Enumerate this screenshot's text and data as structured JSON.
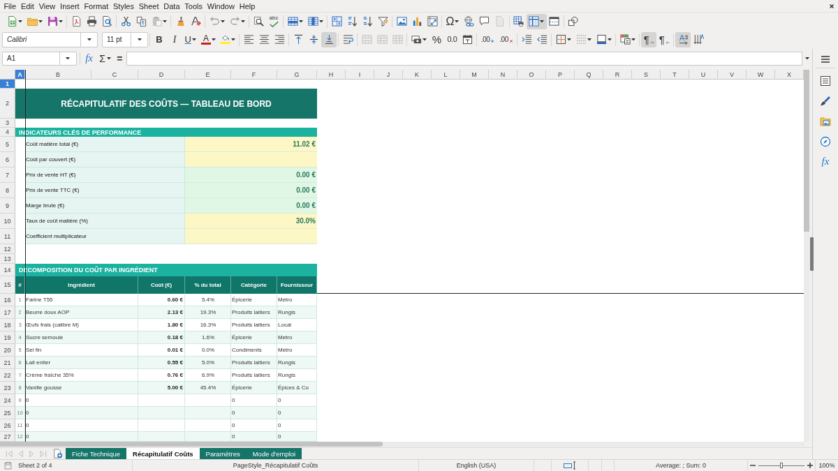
{
  "menu_bar": [
    "File",
    "Edit",
    "View",
    "Insert",
    "Format",
    "Styles",
    "Sheet",
    "Data",
    "Tools",
    "Window",
    "Help"
  ],
  "standard_toolbar": [
    {
      "pressed": false,
      "disabled": false
    },
    {
      "pressed": false,
      "disabled": false
    },
    {
      "pressed": false,
      "disabled": false
    },
    {
      "pressed": false,
      "disabled": false
    },
    {
      "pressed": false,
      "disabled": false
    },
    {
      "pressed": false,
      "disabled": false
    },
    {
      "pressed": false,
      "disabled": false
    },
    {
      "pressed": false,
      "disabled": false
    },
    {
      "pressed": false,
      "disabled": true
    },
    {
      "pressed": false,
      "disabled": false
    },
    {
      "pressed": false,
      "disabled": false
    },
    {
      "pressed": false,
      "disabled": true
    },
    {
      "pressed": false,
      "disabled": true
    },
    {
      "pressed": false,
      "disabled": false
    },
    {
      "glyph": "abc",
      "pressed": false,
      "disabled": false
    },
    {
      "pressed": false,
      "disabled": false
    },
    {
      "pressed": false,
      "disabled": false
    },
    {
      "pressed": false,
      "disabled": false
    },
    {
      "pressed": false,
      "disabled": false
    },
    {
      "pressed": false,
      "disabled": false
    },
    {
      "pressed": false,
      "disabled": false
    },
    {
      "pressed": false,
      "disabled": false
    },
    {
      "pressed": false,
      "disabled": false
    },
    {
      "pressed": false,
      "disabled": false
    },
    {
      "glyph": "Ω",
      "pressed": false,
      "disabled": false
    },
    {
      "pressed": false,
      "disabled": false
    },
    {
      "pressed": false,
      "disabled": false
    },
    {
      "pressed": false,
      "disabled": true
    },
    {
      "pressed": false,
      "disabled": false
    },
    {
      "pressed": true,
      "disabled": false
    },
    {
      "pressed": false,
      "disabled": false
    },
    {
      "pressed": false,
      "disabled": false
    }
  ],
  "formatting_toolbar": {
    "font_name": "Calibri",
    "font_size": "11 pt",
    "buttons": [
      {
        "glyph": "B",
        "pressed": false,
        "disabled": false
      },
      {
        "glyph": "I",
        "pressed": false,
        "disabled": false
      },
      {
        "glyph": "U",
        "pressed": false,
        "disabled": false
      },
      {
        "glyph": "A",
        "pressed": false,
        "disabled": false
      },
      {
        "pressed": false,
        "disabled": false
      },
      {
        "pressed": false,
        "disabled": false
      },
      {
        "pressed": false,
        "disabled": false
      },
      {
        "pressed": false,
        "disabled": false
      },
      {
        "pressed": false,
        "disabled": false
      },
      {
        "pressed": false,
        "disabled": false
      },
      {
        "pressed": true,
        "disabled": false
      },
      {
        "pressed": false,
        "disabled": false
      },
      {
        "pressed": false,
        "disabled": true
      },
      {
        "pressed": false,
        "disabled": true
      },
      {
        "pressed": false,
        "disabled": true
      },
      {
        "pressed": false,
        "disabled": false
      },
      {
        "glyph": "%",
        "pressed": false,
        "disabled": false
      },
      {
        "glyph": "0.0",
        "pressed": false,
        "disabled": false
      },
      {
        "pressed": false,
        "disabled": false
      },
      {
        "glyph": ".00",
        "pressed": false,
        "disabled": false
      },
      {
        "glyph": ".00",
        "pressed": false,
        "disabled": false
      },
      {
        "pressed": false,
        "disabled": false
      },
      {
        "pressed": false,
        "disabled": false
      },
      {
        "pressed": false,
        "disabled": false
      },
      {
        "pressed": false,
        "disabled": true
      },
      {
        "pressed": false,
        "disabled": false
      },
      {
        "pressed": false,
        "disabled": false
      },
      {
        "glyph": "¶",
        "pressed": true,
        "disabled": false
      },
      {
        "glyph": "¶",
        "pressed": false,
        "disabled": false
      },
      {
        "pressed": true,
        "disabled": false
      },
      {
        "pressed": false,
        "disabled": false
      }
    ]
  },
  "formula_bar": {
    "name_box": "A1",
    "function_wizard": "fx",
    "sum": "Σ",
    "formula": "="
  },
  "sheet": {
    "column_headers": [
      {
        "label": "A",
        "selected": true
      },
      {
        "label": "B",
        "selected": false
      },
      {
        "label": "C",
        "selected": false
      },
      {
        "label": "D",
        "selected": false
      },
      {
        "label": "E",
        "selected": false
      },
      {
        "label": "F",
        "selected": false
      },
      {
        "label": "G",
        "selected": false
      },
      {
        "label": "H",
        "selected": false
      },
      {
        "label": "I",
        "selected": false
      },
      {
        "label": "J",
        "selected": false
      },
      {
        "label": "K",
        "selected": false
      },
      {
        "label": "L",
        "selected": false
      },
      {
        "label": "M",
        "selected": false
      },
      {
        "label": "N",
        "selected": false
      },
      {
        "label": "O",
        "selected": false
      },
      {
        "label": "P",
        "selected": false
      },
      {
        "label": "Q",
        "selected": false
      },
      {
        "label": "R",
        "selected": false
      },
      {
        "label": "S",
        "selected": false
      },
      {
        "label": "T",
        "selected": false
      },
      {
        "label": "U",
        "selected": false
      },
      {
        "label": "V",
        "selected": false
      },
      {
        "label": "W",
        "selected": false
      },
      {
        "label": "X",
        "selected": false
      }
    ],
    "row_headers": [
      {
        "label": "1",
        "selected": true
      },
      {
        "label": "2",
        "selected": false
      },
      {
        "label": "3",
        "selected": false
      },
      {
        "label": "4",
        "selected": false
      },
      {
        "label": "5",
        "selected": false
      },
      {
        "label": "6",
        "selected": false
      },
      {
        "label": "7",
        "selected": false
      },
      {
        "label": "8",
        "selected": false
      },
      {
        "label": "9",
        "selected": false
      },
      {
        "label": "10",
        "selected": false
      },
      {
        "label": "11",
        "selected": false
      },
      {
        "label": "12",
        "selected": false
      },
      {
        "label": "13",
        "selected": false
      },
      {
        "label": "14",
        "selected": false
      },
      {
        "label": "15",
        "selected": false
      },
      {
        "label": "16",
        "selected": false
      },
      {
        "label": "17",
        "selected": false
      },
      {
        "label": "18",
        "selected": false
      },
      {
        "label": "19",
        "selected": false
      },
      {
        "label": "20",
        "selected": false
      },
      {
        "label": "21",
        "selected": false
      },
      {
        "label": "22",
        "selected": false
      },
      {
        "label": "23",
        "selected": false
      },
      {
        "label": "24",
        "selected": false
      },
      {
        "label": "25",
        "selected": false
      },
      {
        "label": "26",
        "selected": false
      },
      {
        "label": "27",
        "selected": false
      }
    ],
    "title": "RÉCAPITULATIF DES COÛTS — TABLEAU DE BORD",
    "kpi_section": {
      "heading": "INDICATEURS CLÉS DE PERFORMANCE",
      "rows": [
        {
          "label": "Coût matière total (€)",
          "value": "11.02 €",
          "kind": "input"
        },
        {
          "label": "Coût par couvert (€)",
          "kind": "input"
        },
        {
          "label": "Prix de vente HT (€)",
          "value": "0.00 €",
          "kind": "formula"
        },
        {
          "label": "Prix de vente TTC (€)",
          "value": "0.00 €",
          "kind": "formula"
        },
        {
          "label": "Marge brute (€)",
          "value": "0.00 €",
          "kind": "formula"
        },
        {
          "label": "Taux de coût matière (%)",
          "value": "30.0%",
          "kind": "input"
        },
        {
          "label": "Coefficient multiplicateur",
          "kind": "input"
        }
      ]
    },
    "cost_section": {
      "heading": "DÉCOMPOSITION DU COÛT PAR INGRÉDIENT",
      "columns": [
        "#",
        "Ingrédient",
        "Coût (€)",
        "% du total",
        "Catégorie",
        "Fournisseur"
      ],
      "rows": [
        {
          "index": "1",
          "ingredient": "Farine T55",
          "cost": "0.60 €",
          "share": "5.4%",
          "category": "Épicerie",
          "supplier": "Metro"
        },
        {
          "index": "2",
          "ingredient": "Beurre doux AOP",
          "cost": "2.13 €",
          "share": "19.3%",
          "category": "Produits laitiers",
          "supplier": "Rungis"
        },
        {
          "index": "3",
          "ingredient": "Œufs frais (calibre M)",
          "cost": "1.80 €",
          "share": "16.3%",
          "category": "Produits laitiers",
          "supplier": "Local"
        },
        {
          "index": "4",
          "ingredient": "Sucre semoule",
          "cost": "0.18 €",
          "share": "1.6%",
          "category": "Épicerie",
          "supplier": "Metro"
        },
        {
          "index": "5",
          "ingredient": "Sel fin",
          "cost": "0.01 €",
          "share": "0.0%",
          "category": "Condiments",
          "supplier": "Metro"
        },
        {
          "index": "6",
          "ingredient": "Lait entier",
          "cost": "0.55 €",
          "share": "5.0%",
          "category": "Produits laitiers",
          "supplier": "Rungis"
        },
        {
          "index": "7",
          "ingredient": "Crème fraîche 35%",
          "cost": "0.76 €",
          "share": "6.9%",
          "category": "Produits laitiers",
          "supplier": "Rungis"
        },
        {
          "index": "8",
          "ingredient": "Vanille gousse",
          "cost": "5.00 €",
          "share": "45.4%",
          "category": "Épicerie",
          "supplier": "Épices & Co"
        },
        {
          "index": "9",
          "ingredient": "0",
          "category": "0",
          "supplier": "0"
        },
        {
          "index": "10",
          "ingredient": "0",
          "category": "0",
          "supplier": "0"
        },
        {
          "index": "11",
          "ingredient": "0",
          "category": "0",
          "supplier": "0"
        },
        {
          "index": "12",
          "ingredient": "0",
          "category": "0",
          "supplier": "0"
        }
      ]
    }
  },
  "sheet_tabs": {
    "navigation": [
      {
        "disabled": true
      },
      {
        "disabled": true
      },
      {
        "disabled": true
      },
      {
        "disabled": true
      }
    ],
    "tabs": [
      {
        "label": "Fiche Technique",
        "selected": false
      },
      {
        "label": "Récapitulatif Coûts",
        "selected": true
      },
      {
        "label": "Paramètres",
        "selected": false
      },
      {
        "label": "Mode d'emploi",
        "selected": false
      }
    ]
  },
  "status_bar": {
    "sheet_position": "Sheet 2 of 4",
    "page_style": "PageStyle_Récapitulatif Coûts",
    "language": "English (USA)",
    "selection_summary": "Average: ; Sum: 0",
    "zoom": {
      "level": 0.5,
      "reading": "100%"
    }
  },
  "sidebar": {
    "functions": "fx"
  }
}
